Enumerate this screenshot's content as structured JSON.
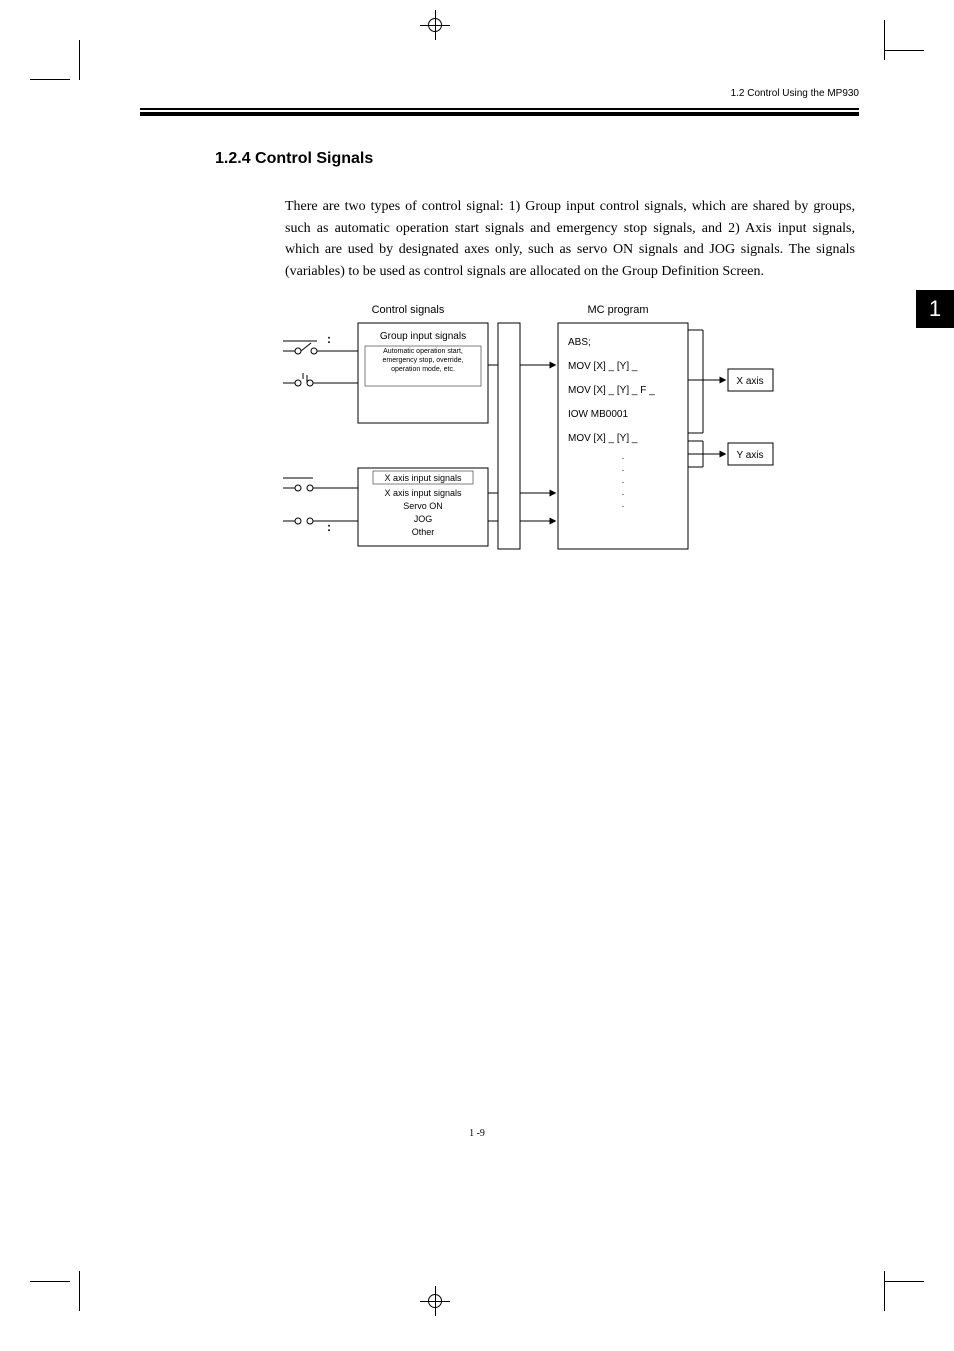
{
  "header": {
    "breadcrumb": "1.2  Control Using the MP930"
  },
  "tab": {
    "chapter": "1"
  },
  "section": {
    "number": "1.2.4",
    "title": "Control Signals",
    "heading_full": "1.2.4  Control Signals"
  },
  "paragraph": "There are two types of control signal: 1) Group input control signals, which are shared by groups, such as automatic operation start signals and emergency stop signals, and 2) Axis input signals, which are used by designated axes only, such as servo ON signals and JOG signals. The signals (variables) to be used as control signals are allocated on the Group Definition Screen.",
  "diagram": {
    "left_header": "Control signals",
    "right_header": "MC program",
    "group_box_title": "Group input signals",
    "group_box_desc": "Automatic operation start, emergency stop, override, operation mode, etc.",
    "axis_box_title": "X axis input signals",
    "axis_box_line2": "X axis input signals",
    "axis_box_line3": "Servo ON",
    "axis_box_line4": "JOG",
    "axis_box_line5": "Other",
    "mc_lines": [
      "ABS;",
      "MOV [X] _ [Y] _",
      "MOV [X] _ [Y] _ F _",
      "IOW MB0001",
      "MOV [X] _ [Y] _"
    ],
    "output_x": "X axis",
    "output_y": "Y axis"
  },
  "footer": {
    "page": "1 -9"
  }
}
